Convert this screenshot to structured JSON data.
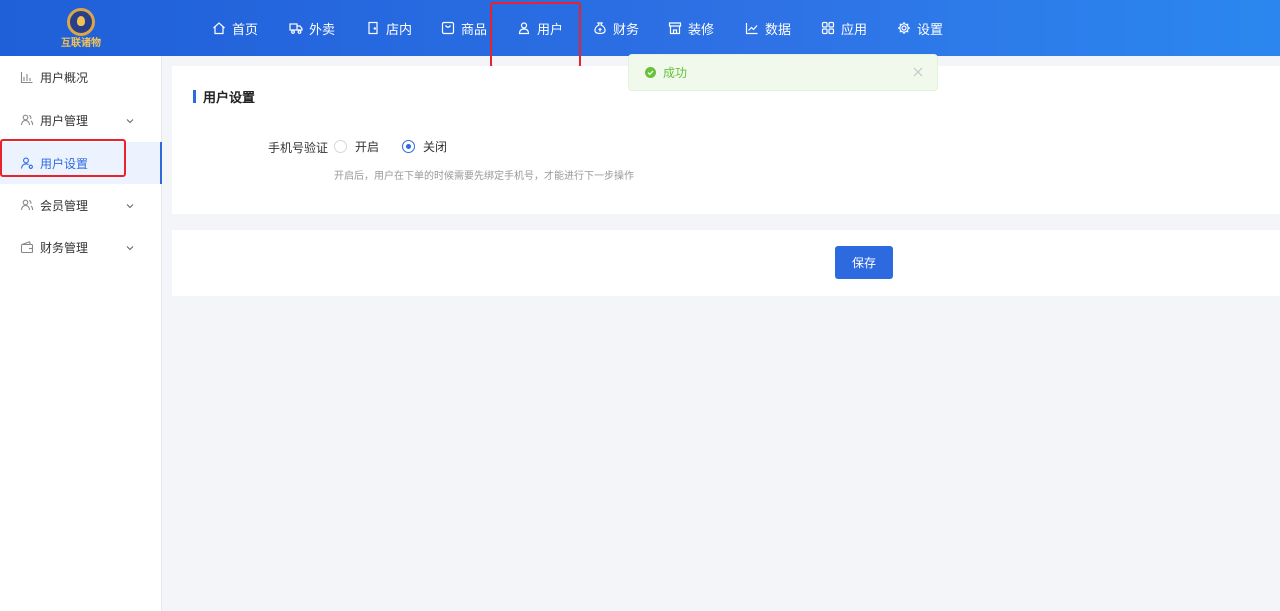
{
  "app": {
    "logo_text": "互联诸物"
  },
  "nav": {
    "items": [
      {
        "label": "首页",
        "icon": "home-icon"
      },
      {
        "label": "外卖",
        "icon": "delivery-icon"
      },
      {
        "label": "店内",
        "icon": "store-door-icon"
      },
      {
        "label": "商品",
        "icon": "goods-icon"
      },
      {
        "label": "用户",
        "icon": "user-icon"
      },
      {
        "label": "财务",
        "icon": "money-bag-icon"
      },
      {
        "label": "装修",
        "icon": "shop-decor-icon"
      },
      {
        "label": "数据",
        "icon": "chart-icon"
      },
      {
        "label": "应用",
        "icon": "apps-icon"
      },
      {
        "label": "设置",
        "icon": "gear-icon"
      }
    ],
    "active": "用户"
  },
  "sidebar": {
    "items": [
      {
        "label": "用户概况",
        "icon": "bar-chart-icon",
        "expandable": false
      },
      {
        "label": "用户管理",
        "icon": "users-icon",
        "expandable": true
      },
      {
        "label": "用户设置",
        "icon": "user-settings-icon",
        "expandable": false,
        "active": true
      },
      {
        "label": "会员管理",
        "icon": "members-icon",
        "expandable": true
      },
      {
        "label": "财务管理",
        "icon": "wallet-icon",
        "expandable": true
      }
    ]
  },
  "main": {
    "section_title": "用户设置",
    "phone_verify": {
      "label": "手机号验证",
      "options": [
        "开启",
        "关闭"
      ],
      "selected": "关闭",
      "help": "开启后，用户在下单的时候需要先绑定手机号，才能进行下一步操作"
    },
    "save_label": "保存"
  },
  "toast": {
    "message": "成功",
    "type": "success"
  },
  "colors": {
    "primary": "#2d6ae0",
    "topbar": "#2e72e6",
    "success": "#67c23a",
    "highlight": "#e8242a"
  }
}
